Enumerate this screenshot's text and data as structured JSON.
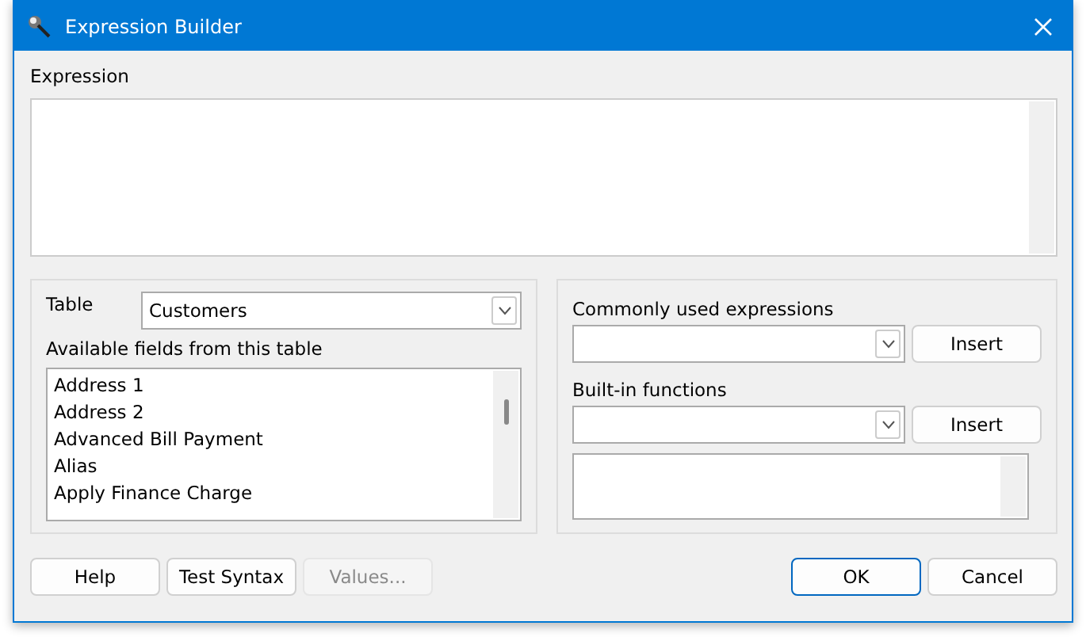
{
  "window": {
    "title": "Expression Builder"
  },
  "expression": {
    "label": "Expression"
  },
  "table": {
    "label": "Table",
    "value": "Customers"
  },
  "fields": {
    "label": "Available fields from this table",
    "items": [
      "Address 1",
      "Address 2",
      "Advanced Bill Payment",
      "Alias",
      "Apply Finance Charge"
    ]
  },
  "common": {
    "label": "Commonly used expressions",
    "button": "Insert"
  },
  "builtin": {
    "label": "Built-in functions",
    "button": "Insert"
  },
  "buttons_left": [
    {
      "label": "Help",
      "disabled": false
    },
    {
      "label": "Test Syntax",
      "disabled": false
    },
    {
      "label": "Values...",
      "disabled": true
    }
  ],
  "buttons_right": [
    {
      "label": "OK",
      "default": true
    },
    {
      "label": "Cancel",
      "default": false
    }
  ]
}
